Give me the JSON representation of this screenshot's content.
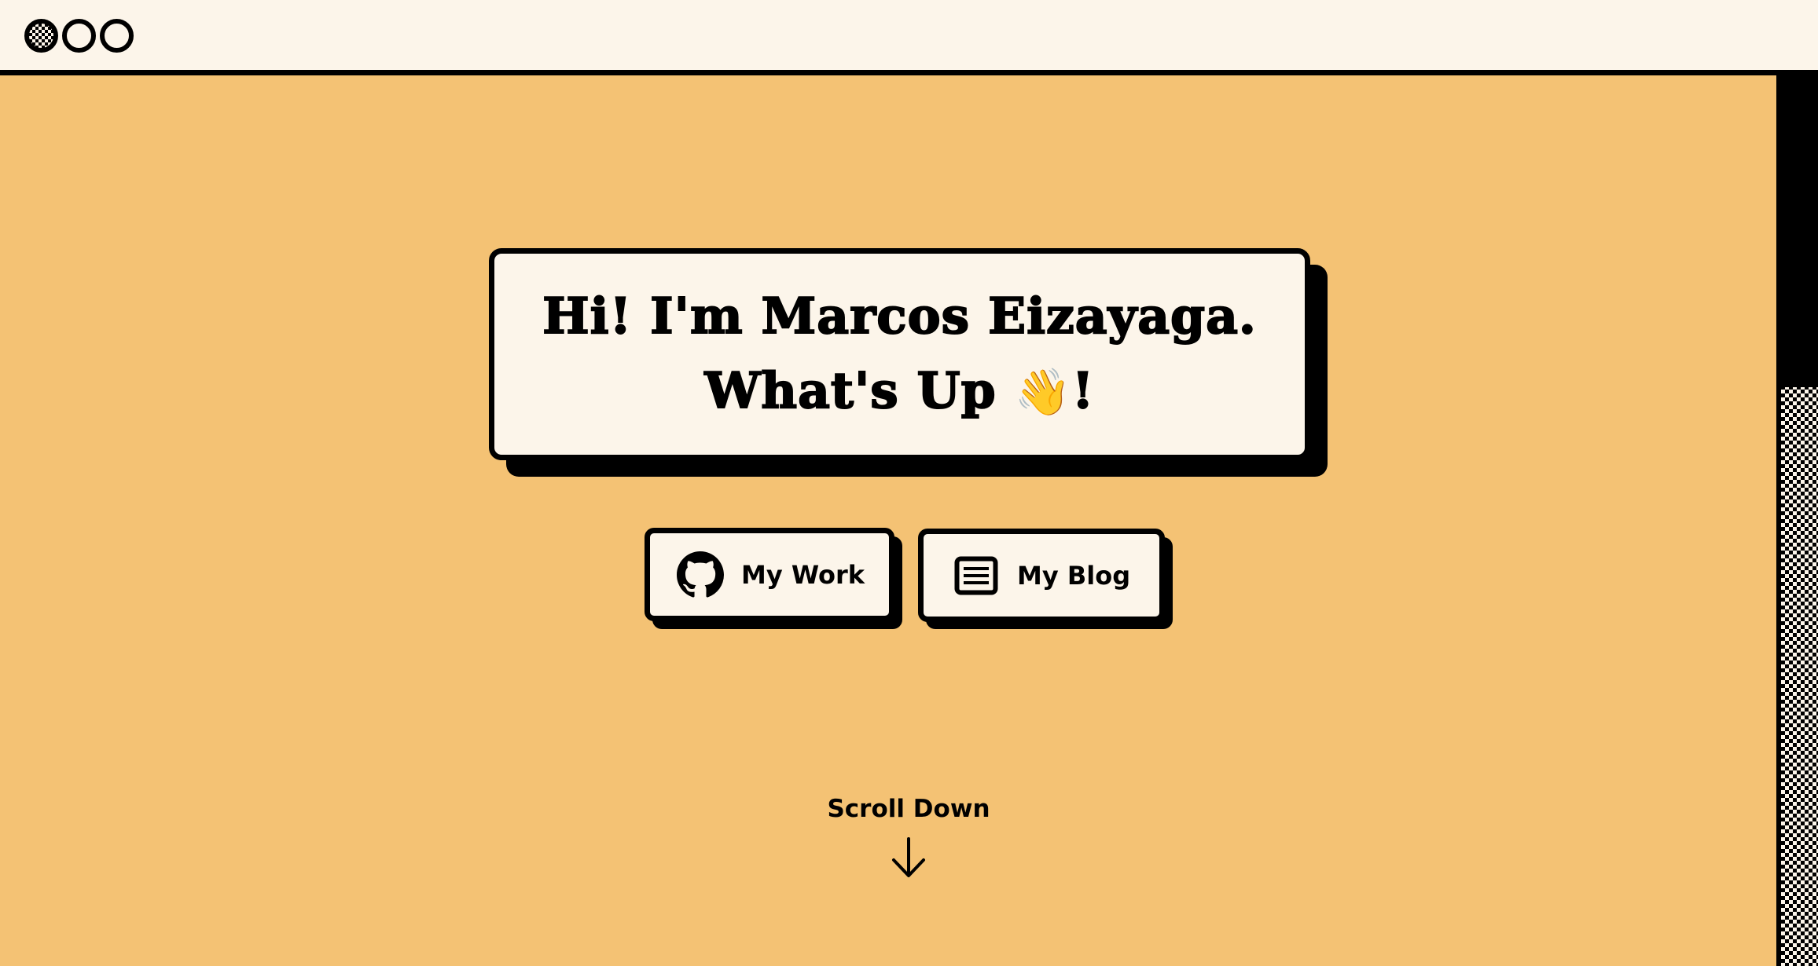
{
  "window": {
    "controls": [
      "close-icon",
      "minimize-icon",
      "maximize-icon"
    ]
  },
  "hero": {
    "line1": "Hi! I'm Marcos Eizayaga.",
    "line2_text": "What's Up ",
    "wave_emoji": "👋",
    "line2_end": "!"
  },
  "buttons": {
    "work": {
      "label": "My Work",
      "icon": "github-icon"
    },
    "blog": {
      "label": "My Blog",
      "icon": "document-icon"
    }
  },
  "scroll": {
    "label": "Scroll Down",
    "icon": "arrow-down-icon"
  },
  "colors": {
    "background": "#f4c274",
    "card": "#fcf5ea",
    "ink": "#000000"
  }
}
